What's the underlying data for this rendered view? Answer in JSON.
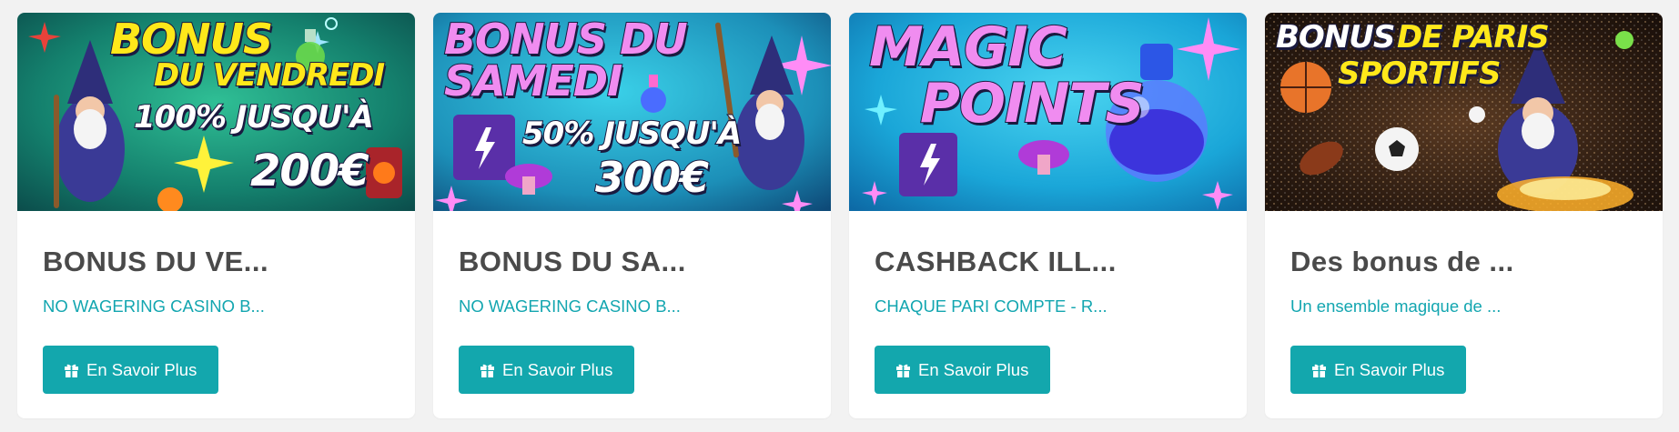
{
  "cards": [
    {
      "banner_lines": [
        "BONUS",
        "DU VENDREDI",
        "100% JUSQU'À",
        "200€"
      ],
      "title": "BONUS DU VE...",
      "subtitle": "NO WAGERING CASINO B...",
      "button_label": "En Savoir Plus",
      "button_icon": "gift-icon"
    },
    {
      "banner_lines": [
        "BONUS DU",
        "SAMEDI",
        "50% JUSQU'À",
        "300€"
      ],
      "title": "BONUS DU SA...",
      "subtitle": "NO WAGERING CASINO B...",
      "button_label": "En Savoir Plus",
      "button_icon": "gift-icon"
    },
    {
      "banner_lines": [
        "MAGIC",
        "POINTS"
      ],
      "title": "CASHBACK ILL...",
      "subtitle": "CHAQUE PARI COMPTE - R...",
      "button_label": "En Savoir Plus",
      "button_icon": "gift-icon"
    },
    {
      "banner_lines": [
        "BONUS",
        "DE PARIS",
        "SPORTIFS"
      ],
      "title": "Des bonus de ...",
      "subtitle": "Un ensemble magique de ...",
      "button_label": "En Savoir Plus",
      "button_icon": "gift-icon"
    }
  ],
  "colors": {
    "page_background": "#f2f2f2",
    "card_background": "#ffffff",
    "title": "#4a4a4a",
    "subtitle": "#13a6b0",
    "button": "#13a7ad",
    "button_text": "#ffffff",
    "banner_yellow": "#ffe81a",
    "banner_pink": "#f08cf0",
    "banner_white": "#ffffff"
  }
}
